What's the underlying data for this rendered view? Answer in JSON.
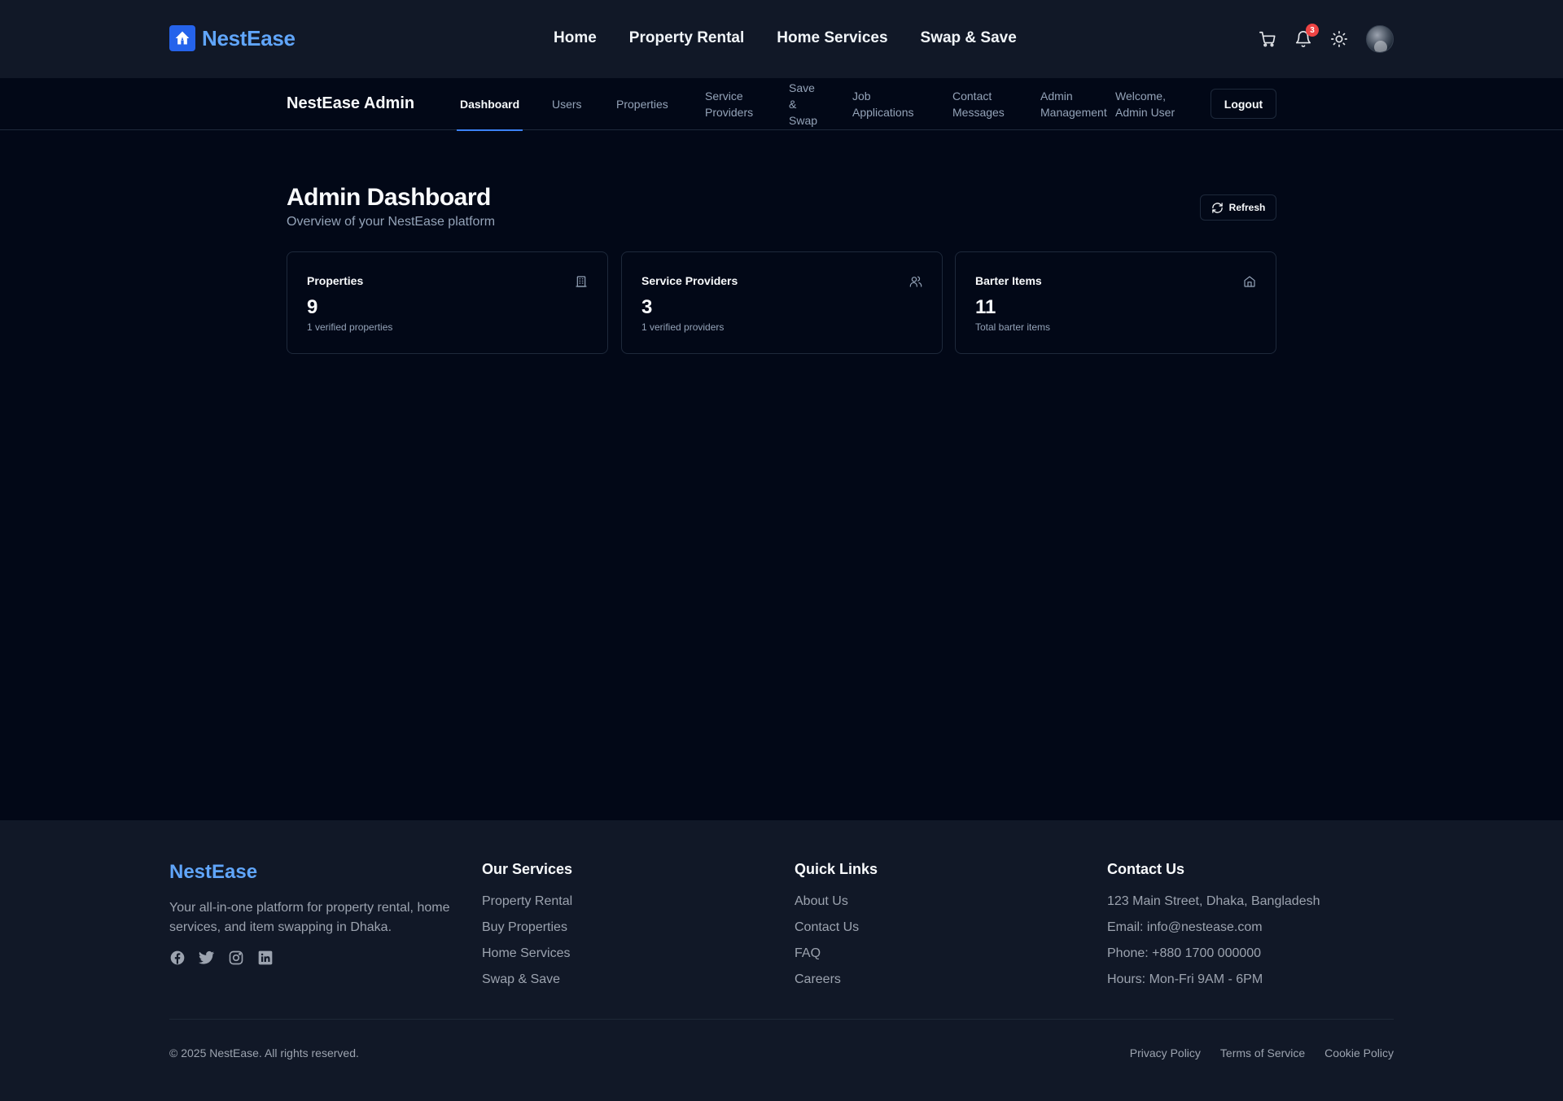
{
  "header": {
    "brand": "NestEase",
    "nav": [
      "Home",
      "Property Rental",
      "Home Services",
      "Swap & Save"
    ],
    "notification_count": "3",
    "icons": [
      "cart-icon",
      "bell-icon",
      "sun-icon",
      "avatar"
    ]
  },
  "admin_nav": {
    "title": "NestEase Admin",
    "items": [
      {
        "label": "Dashboard",
        "active": true
      },
      {
        "label": "Users",
        "active": false
      },
      {
        "label": "Properties",
        "active": false
      },
      {
        "label": "Service Providers",
        "active": false
      },
      {
        "label": "Save & Swap",
        "active": false
      },
      {
        "label": "Job Applications",
        "active": false
      },
      {
        "label": "Contact Messages",
        "active": false
      },
      {
        "label": "Admin Management",
        "active": false
      }
    ],
    "welcome": "Welcome, Admin User",
    "logout": "Logout"
  },
  "page": {
    "title": "Admin Dashboard",
    "subtitle": "Overview of your NestEase platform",
    "refresh": "Refresh"
  },
  "stats": [
    {
      "title": "Properties",
      "value": "9",
      "note": "1 verified properties",
      "icon": "building-icon"
    },
    {
      "title": "Service Providers",
      "value": "3",
      "note": "1 verified providers",
      "icon": "users-icon"
    },
    {
      "title": "Barter Items",
      "value": "11",
      "note": "Total barter items",
      "icon": "home-icon"
    }
  ],
  "footer": {
    "brand": "NestEase",
    "description": "Your all-in-one platform for property rental, home services, and item swapping in Dhaka.",
    "social": [
      "facebook-icon",
      "twitter-icon",
      "instagram-icon",
      "linkedin-icon"
    ],
    "services": {
      "title": "Our Services",
      "links": [
        "Property Rental",
        "Buy Properties",
        "Home Services",
        "Swap & Save"
      ]
    },
    "quick_links": {
      "title": "Quick Links",
      "links": [
        "About Us",
        "Contact Us",
        "FAQ",
        "Careers"
      ]
    },
    "contact": {
      "title": "Contact Us",
      "lines": [
        "123 Main Street, Dhaka, Bangladesh",
        "Email: info@nestease.com",
        "Phone: +880 1700 000000",
        "Hours: Mon-Fri 9AM - 6PM"
      ]
    },
    "copyright": "© 2025 NestEase. All rights reserved.",
    "legal": [
      "Privacy Policy",
      "Terms of Service",
      "Cookie Policy"
    ]
  },
  "colors": {
    "background": "#020817",
    "header_bg": "#111827",
    "brand_blue": "#60a5fa",
    "accent_blue": "#3b82f6",
    "badge_red": "#ef4444"
  }
}
